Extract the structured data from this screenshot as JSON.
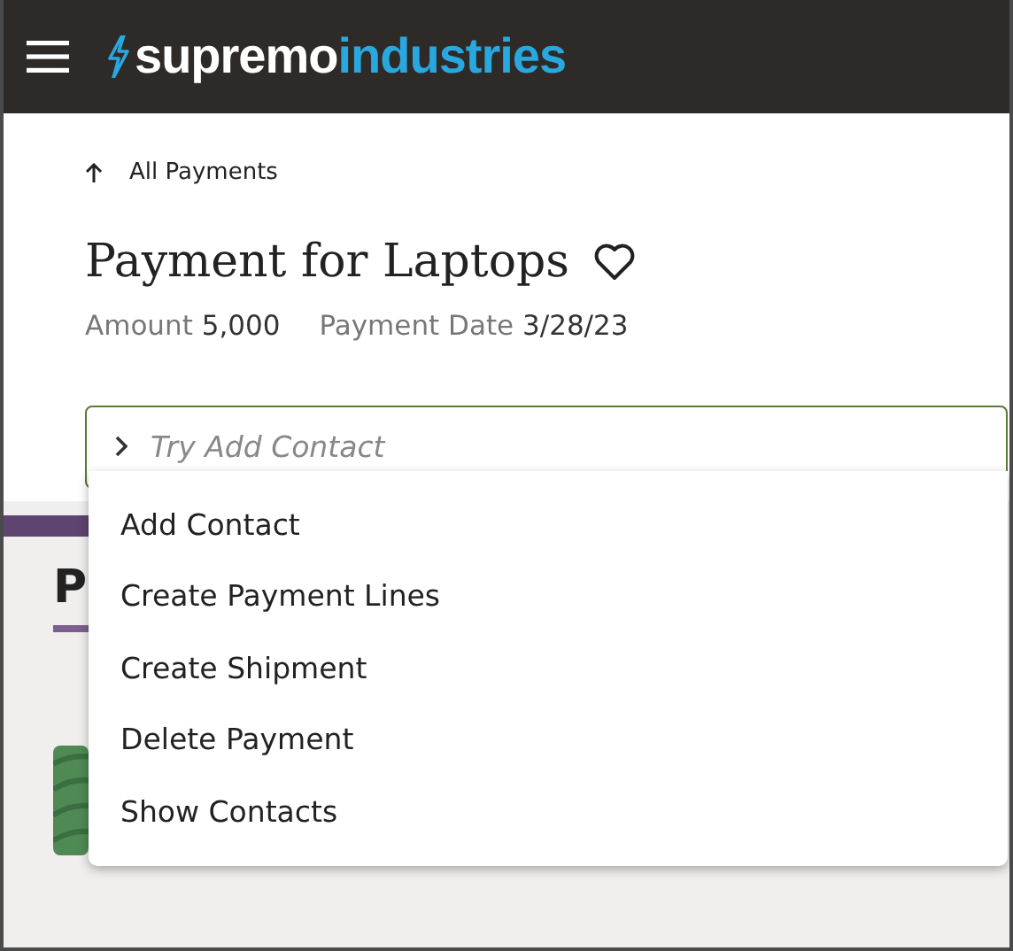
{
  "header": {
    "brand": [
      "supremo",
      "industries"
    ]
  },
  "back_link": {
    "label": "All Payments"
  },
  "title": "Payment for Laptops",
  "favorite": false,
  "fields": [
    {
      "label": "Amount",
      "value": "5,000"
    },
    {
      "label": "Payment Date",
      "value": "3/28/23"
    }
  ],
  "command_field": {
    "placeholder": "Try Add Contact"
  },
  "menu": [
    {
      "label": "Add Contact"
    },
    {
      "label": "Create Payment Lines"
    },
    {
      "label": "Create Shipment"
    },
    {
      "label": "Delete Payment"
    },
    {
      "label": "Show Contacts"
    }
  ],
  "section": {
    "heading": "P"
  }
}
